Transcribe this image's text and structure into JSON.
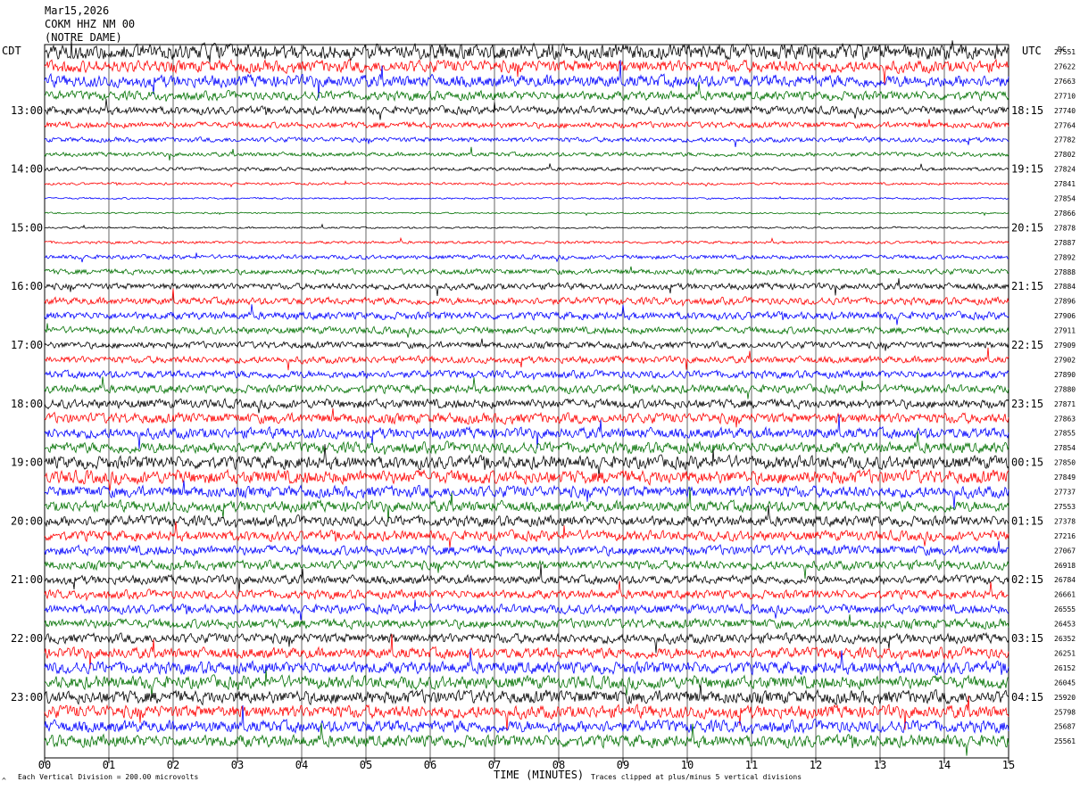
{
  "header": {
    "date": "Mar15,2026",
    "station": "COKM HHZ NM 00",
    "network": "(NOTRE DAME)",
    "left_tz": "CDT",
    "right_tz": "UTC",
    "dc_label": "DC"
  },
  "footer": {
    "scale_note": "Each Vertical Division =  200.00 microvolts",
    "xlabel": "TIME (MINUTES)",
    "clip_note": "Traces clipped at plus/minus 5 vertical divisions",
    "corner_mark": "^"
  },
  "chart_data": {
    "type": "line",
    "title": "Mar15,2026 COKM HHZ NM 00",
    "xlabel": "TIME (MINUTES)",
    "x_ticks": [
      "00",
      "01",
      "02",
      "03",
      "04",
      "05",
      "06",
      "07",
      "08",
      "09",
      "10",
      "11",
      "12",
      "13",
      "14",
      "15"
    ],
    "xlim": [
      0,
      15
    ],
    "trace_colors": [
      "#000000",
      "#ff0000",
      "#0000ff",
      "#007000"
    ],
    "grid": true,
    "trace_count": 48,
    "left_hour_labels": [
      "13:00",
      "14:00",
      "15:00",
      "16:00",
      "17:00",
      "18:00",
      "19:00",
      "20:00",
      "21:00",
      "22:00",
      "23:00"
    ],
    "right_hour_labels": [
      "18:15",
      "19:15",
      "20:15",
      "21:15",
      "22:15",
      "23:15",
      "00:15",
      "01:15",
      "02:15",
      "03:15",
      "04:15"
    ],
    "dc_offsets": [
      "27551",
      "27622",
      "27663",
      "27710",
      "27740",
      "27764",
      "27782",
      "27802",
      "27824",
      "27841",
      "27854",
      "27866",
      "27878",
      "27887",
      "27892",
      "27888",
      "27884",
      "27896",
      "27906",
      "27911",
      "27909",
      "27902",
      "27890",
      "27880",
      "27871",
      "27863",
      "27855",
      "27854",
      "27850",
      "27849",
      "27737",
      "27553",
      "27378",
      "27216",
      "27067",
      "26918",
      "26784",
      "26661",
      "26555",
      "26453",
      "26352",
      "26251",
      "26152",
      "26045",
      "25920",
      "25798",
      "25687",
      "25561"
    ],
    "amplitude_levels": [
      5,
      4,
      4,
      3,
      2.6,
      2,
      1.6,
      1.4,
      1.2,
      0.8,
      0.6,
      0.5,
      0.6,
      0.9,
      1.4,
      1.8,
      2.1,
      2.4,
      2.5,
      2.3,
      2.2,
      2.3,
      2.5,
      2.7,
      3,
      3.4,
      3.5,
      3.6,
      4.2,
      4.4,
      3.8,
      3.6,
      3.4,
      3.3,
      3.2,
      3,
      2.9,
      2.9,
      3,
      3.1,
      3.2,
      3.6,
      4,
      4.2,
      4.3,
      4.2,
      4,
      4
    ]
  }
}
